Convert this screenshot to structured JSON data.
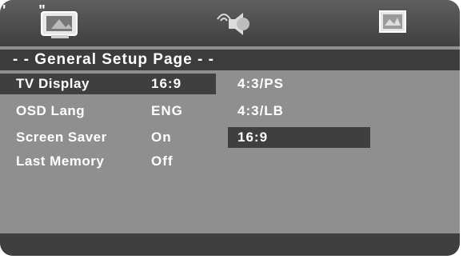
{
  "header": {
    "corner_marks": "' \"",
    "tabs": [
      {
        "icon": "general-setup-tv-icon"
      },
      {
        "icon": "audio-speaker-icon"
      },
      {
        "icon": "video-preferences-icon"
      }
    ]
  },
  "page": {
    "title": "- - General Setup Page - -"
  },
  "menu": {
    "items": [
      {
        "label": "TV Display",
        "value": "16:9",
        "selected": true
      },
      {
        "label": "OSD Lang",
        "value": "ENG"
      },
      {
        "label": "Screen Saver",
        "value": "On"
      },
      {
        "label": "Last Memory",
        "value": "Off"
      }
    ]
  },
  "options": {
    "items": [
      {
        "label": "4:3/PS"
      },
      {
        "label": "4:3/LB"
      },
      {
        "label": "16:9",
        "highlighted": true
      }
    ]
  },
  "colors": {
    "panel": "#8f8f8f",
    "bar_dark": "#3f3f3f",
    "text": "#ffffff"
  }
}
